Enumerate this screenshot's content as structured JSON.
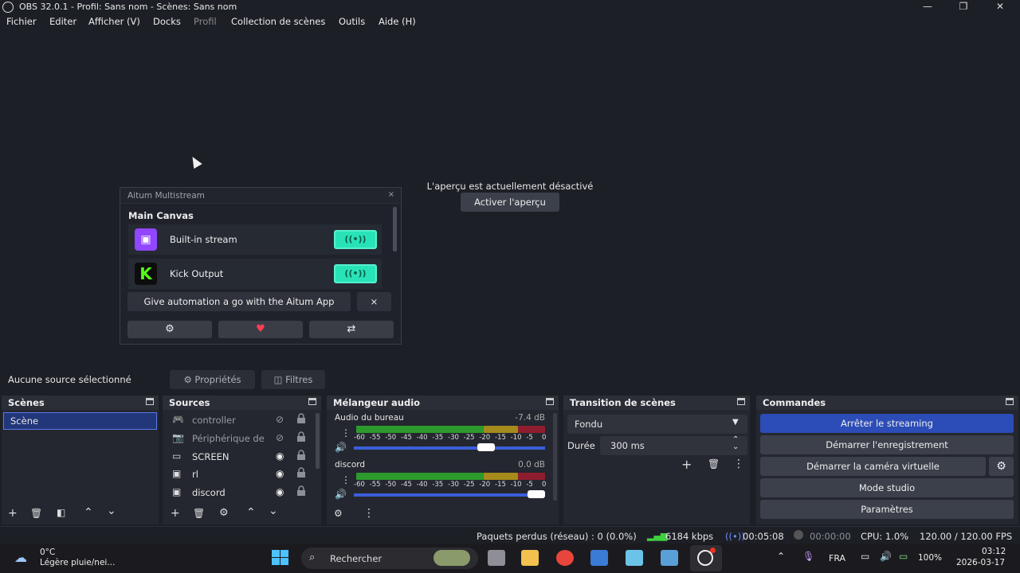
{
  "window": {
    "title": "OBS 32.0.1 - Profil: Sans nom - Scènes: Sans nom",
    "minimize": "—",
    "maximize": "❐",
    "close": "✕"
  },
  "menu": [
    "Fichier",
    "Editer",
    "Afficher (V)",
    "Docks",
    "Profil",
    "Collection de scènes",
    "Outils",
    "Aide (H)"
  ],
  "preview": {
    "disabled_text": "L'aperçu est actuellement désactivé",
    "enable_button": "Activer l'aperçu"
  },
  "aitum": {
    "title": "Aitum Multistream",
    "close": "×",
    "section": "Main Canvas",
    "outputs": [
      {
        "name": "Built-in stream",
        "logo_color": "#9146ff",
        "logo_text": "▣",
        "state": "on"
      },
      {
        "name": "Kick Output",
        "logo_color": "#111111",
        "logo_text": "K",
        "state": "on"
      }
    ],
    "promo": "Give automation a go with the Aitum App",
    "promo_close": "×"
  },
  "source_bar": {
    "selected": "Aucune source sélectionné",
    "properties": "Propriétés",
    "filters": "Filtres"
  },
  "scenes": {
    "title": "Scènes",
    "items": [
      "Scène"
    ]
  },
  "sources": {
    "title": "Sources",
    "items": [
      {
        "name": "controller",
        "icon": "gamepad-icon",
        "visible": false
      },
      {
        "name": "Périphérique de",
        "icon": "camera-icon",
        "visible": false
      },
      {
        "name": "SCREEN",
        "icon": "monitor-icon",
        "visible": true
      },
      {
        "name": "rl",
        "icon": "window-icon",
        "visible": true
      },
      {
        "name": "discord",
        "icon": "window-icon",
        "visible": true
      }
    ]
  },
  "mixer": {
    "title": "Mélangeur audio",
    "scale": [
      "-60",
      "-55",
      "-50",
      "-45",
      "-40",
      "-35",
      "-30",
      "-25",
      "-20",
      "-15",
      "-10",
      "-5",
      "0"
    ],
    "channels": [
      {
        "name": "Audio du bureau",
        "db": "-7.4 dB",
        "volume": 0.92
      },
      {
        "name": "discord",
        "db": "0.0 dB",
        "volume": 1.0
      }
    ]
  },
  "transitions": {
    "title": "Transition de scènes",
    "selected": "Fondu",
    "duration_label": "Durée",
    "duration_value": "300 ms"
  },
  "controls": {
    "title": "Commandes",
    "buttons": [
      "Arrêter le streaming",
      "Démarrer l'enregistrement",
      "Démarrer la caméra virtuelle",
      "Mode studio",
      "Paramètres"
    ],
    "accent": "#2c4db7"
  },
  "status": {
    "dropped": "Paquets perdus (réseau) : 0 (0.0%)",
    "bitrate": "6184 kbps",
    "stream_time": "00:05:08",
    "rec_time": "00:00:00",
    "cpu": "CPU: 1.0%",
    "fps": "120.00 / 120.00 FPS"
  },
  "taskbar": {
    "temp": "0°C",
    "weather": "Légère pluie/nei...",
    "search": "Rechercher",
    "lang": "FRA",
    "battery": "100%",
    "time": "03:12",
    "date": "2026-03-17"
  }
}
